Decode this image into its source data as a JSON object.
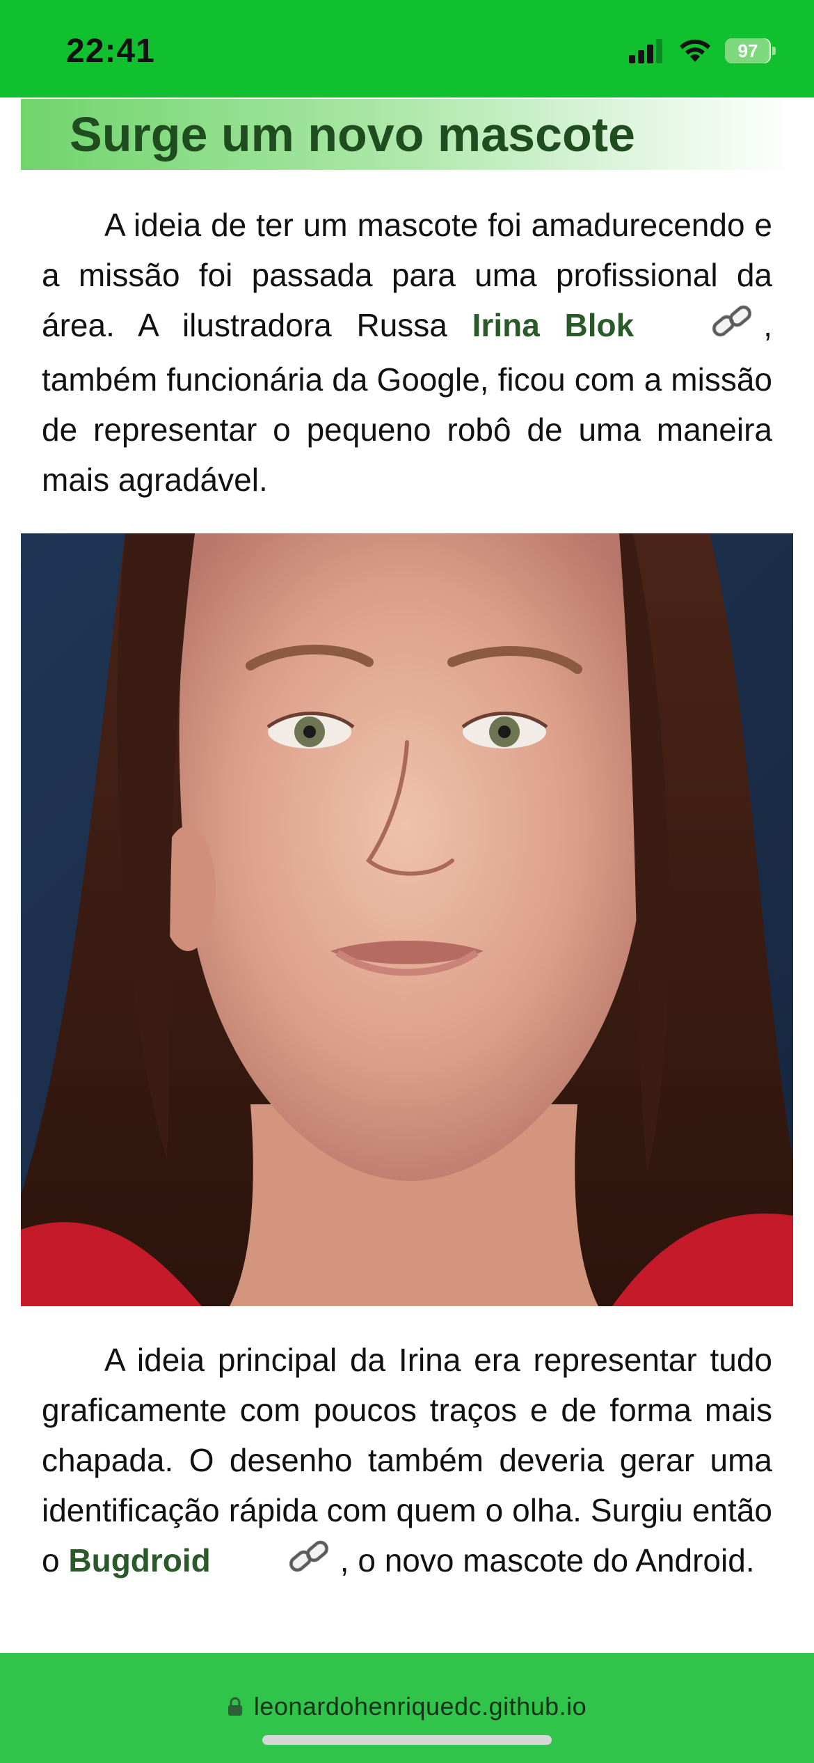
{
  "status_bar": {
    "time": "22:41",
    "battery": "97",
    "battery_level": 0.97,
    "icons": [
      "signal-icon",
      "wifi-icon",
      "battery-icon"
    ]
  },
  "article": {
    "heading": "Surge um novo mascote",
    "para1_text": "A ideia de ter um mascote foi amadurecendo e a missão foi passada para uma profissional da área. A ilustradora Russa",
    "para1_link": "Irina Blok",
    "para1_tail": ", também funcionária da Google, ficou com a missão de representar o pequeno robô de uma maneira mais agradável.",
    "para2_text": "A ideia principal da Irina era representar tudo graficamente com poucos traços e de forma mais chapada. O desenho também deveria gerar uma identificação rápida com quem o olha. Surgiu então o",
    "para2_link": "Bugdroid",
    "para2_tail": ", o novo mascote do Android."
  },
  "browser": {
    "url": "leonardohenriquedc.github.io"
  },
  "colors": {
    "status_bar": "#10c02f",
    "bottom_bar": "#30c44a",
    "heading_text": "#1f4d1f",
    "link_text": "#2a5a2a"
  }
}
